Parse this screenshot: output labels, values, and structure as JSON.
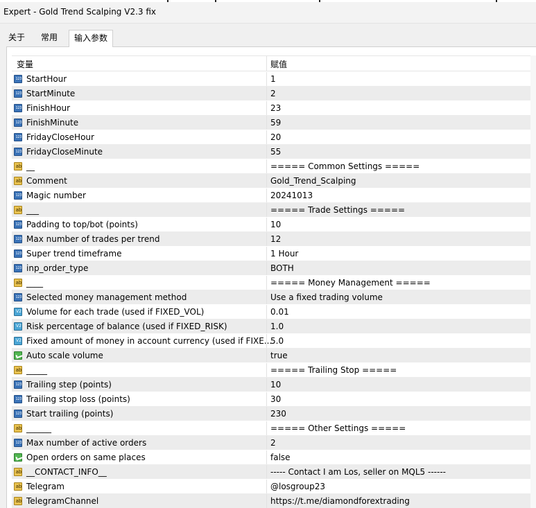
{
  "window": {
    "title": "Expert - Gold Trend Scalping V2.3 fix"
  },
  "tabs": [
    {
      "label": "关于"
    },
    {
      "label": "常用"
    },
    {
      "label": "输入参数"
    }
  ],
  "grid": {
    "headers": {
      "variable": "变量",
      "value": "赋值"
    },
    "rows": [
      {
        "type": "int",
        "name": "StartHour",
        "value": "1"
      },
      {
        "type": "int",
        "name": "StartMinute",
        "value": "2"
      },
      {
        "type": "int",
        "name": "FinishHour",
        "value": "23"
      },
      {
        "type": "int",
        "name": "FinishMinute",
        "value": "59"
      },
      {
        "type": "int",
        "name": "FridayCloseHour",
        "value": "20"
      },
      {
        "type": "int",
        "name": "FridayCloseMinute",
        "value": "55"
      },
      {
        "type": "str",
        "name": "__",
        "value": "===== Common Settings ====="
      },
      {
        "type": "str",
        "name": "Comment",
        "value": "Gold_Trend_Scalping"
      },
      {
        "type": "int",
        "name": "Magic number",
        "value": "20241013"
      },
      {
        "type": "str",
        "name": "___",
        "value": "===== Trade Settings ====="
      },
      {
        "type": "int",
        "name": "Padding to top/bot (points)",
        "value": "10"
      },
      {
        "type": "int",
        "name": "Max number of trades per trend",
        "value": "12"
      },
      {
        "type": "int",
        "name": "Super trend timeframe",
        "value": "1 Hour"
      },
      {
        "type": "int",
        "name": "inp_order_type",
        "value": "BOTH"
      },
      {
        "type": "str",
        "name": "____",
        "value": "===== Money Management ====="
      },
      {
        "type": "int",
        "name": "Selected money management method",
        "value": "Use a fixed trading volume"
      },
      {
        "type": "dbl",
        "name": "Volume for each trade (used if FIXED_VOL)",
        "value": "0.01"
      },
      {
        "type": "dbl",
        "name": "Risk percentage of balance (used if FIXED_RISK)",
        "value": "1.0"
      },
      {
        "type": "dbl",
        "name": "Fixed amount of money in account currency (used if FIXE...",
        "value": "5.0"
      },
      {
        "type": "bool",
        "name": "Auto scale volume",
        "value": "true"
      },
      {
        "type": "str",
        "name": "_____",
        "value": "===== Trailing Stop ====="
      },
      {
        "type": "int",
        "name": "Trailing step (points)",
        "value": "10"
      },
      {
        "type": "int",
        "name": "Trailing stop loss (points)",
        "value": "30"
      },
      {
        "type": "int",
        "name": "Start trailing (points)",
        "value": "230"
      },
      {
        "type": "str",
        "name": "______",
        "value": "===== Other Settings  ====="
      },
      {
        "type": "int",
        "name": "Max number of active orders",
        "value": "2"
      },
      {
        "type": "bool",
        "name": "Open orders on same places",
        "value": "false"
      },
      {
        "type": "str",
        "name": "__CONTACT_INFO__",
        "value": "----- Contact I am Los, seller on MQL5 ------"
      },
      {
        "type": "str",
        "name": "Telegram",
        "value": "@losgroup23"
      },
      {
        "type": "str",
        "name": "TelegramChannel",
        "value": "https://t.me/diamondforextrading"
      }
    ]
  }
}
